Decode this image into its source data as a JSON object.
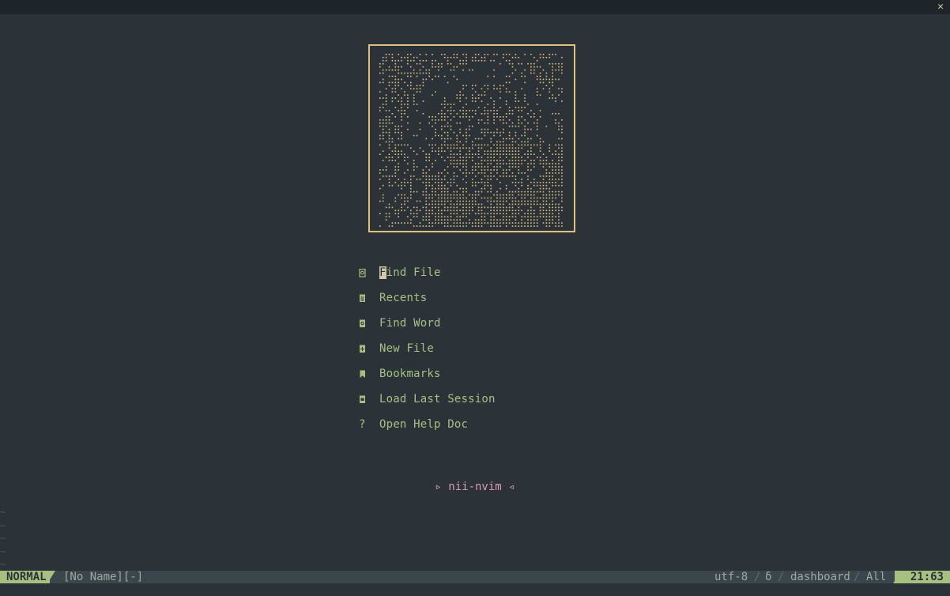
{
  "window": {
    "close_label": "✕"
  },
  "dashboard": {
    "menu": [
      {
        "icon": "search-file-icon",
        "label": "Find File",
        "cursor_char": "F",
        "rest": "ind File"
      },
      {
        "icon": "file-icon",
        "label": "Recents"
      },
      {
        "icon": "search-word-icon",
        "label": "Find Word"
      },
      {
        "icon": "new-file-icon",
        "label": "New File"
      },
      {
        "icon": "bookmark-icon",
        "label": "Bookmarks"
      },
      {
        "icon": "session-icon",
        "label": "Load Last Session"
      },
      {
        "icon": "help-icon",
        "label": "Open Help Doc",
        "glyph": "?"
      }
    ],
    "footer": "▹ nii-nvim ◃"
  },
  "empty_line_marker": "~",
  "statusline": {
    "mode": "NORMAL",
    "filename": "[No Name][-]",
    "encoding": "utf-8",
    "sep1": "/",
    "filetype_icon": "δ",
    "sep2": "/",
    "filetype": "dashboard",
    "sep3": "/",
    "scroll": "All",
    "position": "21:63"
  },
  "colors": {
    "background": "#2b3339",
    "accent": "#a7c080",
    "art": "#e5c07b",
    "footer": "#d699b6"
  }
}
